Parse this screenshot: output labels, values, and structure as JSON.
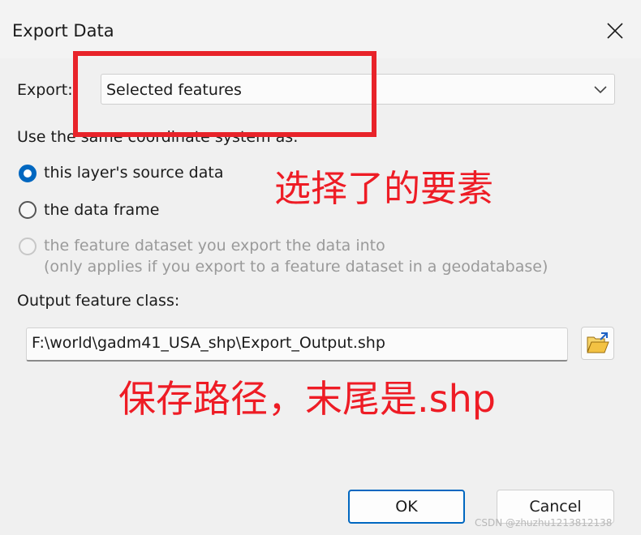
{
  "window": {
    "title": "Export Data"
  },
  "export": {
    "label": "Export:",
    "selected": "Selected features"
  },
  "coordinate_system": {
    "label": "Use the same coordinate system as:",
    "options": [
      {
        "label": "this layer's source data",
        "state": "checked"
      },
      {
        "label": "the data frame",
        "state": "unchecked"
      },
      {
        "label": "the feature dataset you export the data into",
        "note": "(only applies if you export to a feature dataset in a geodatabase)",
        "state": "disabled"
      }
    ]
  },
  "output": {
    "label": "Output feature class:",
    "path": "F:\\world\\gadm41_USA_shp\\Export_Output.shp"
  },
  "buttons": {
    "ok": "OK",
    "cancel": "Cancel"
  },
  "annotations": {
    "note1": "选择了的要素",
    "note2": "保存路径，末尾是.shp",
    "color": "#ee1c25"
  },
  "watermark": "CSDN @zhuzhu1213812138",
  "colors": {
    "accent": "#0067c0",
    "annotation": "#e8232a"
  },
  "icons": {
    "close": "close-icon",
    "dropdown": "chevron-down-icon",
    "browse": "folder-open-icon"
  }
}
